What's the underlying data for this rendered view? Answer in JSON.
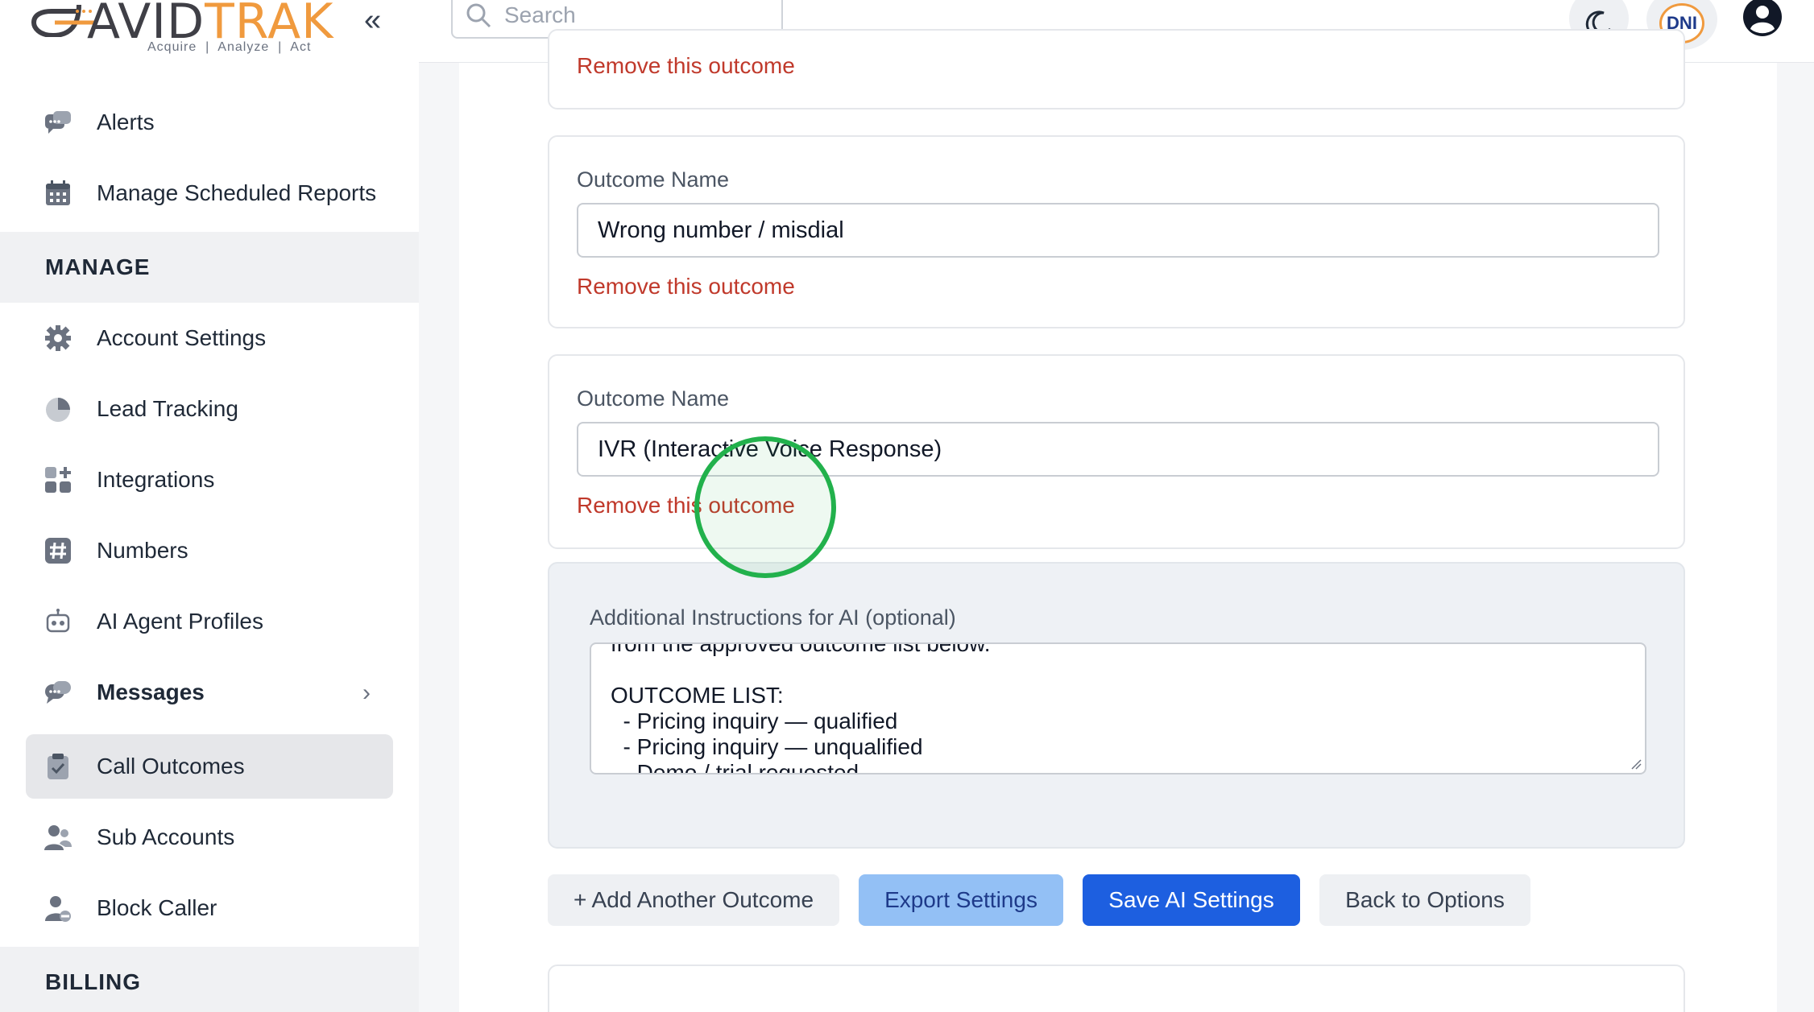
{
  "brand": {
    "name_a": "AVID",
    "name_b": "TRAK",
    "tagline": "Acquire  |  Analyze  |  Act",
    "collapse_glyph": "«"
  },
  "sidebar": {
    "items_top": [
      {
        "label": "Alerts",
        "icon": "chat-bubble-icon"
      },
      {
        "label": "Manage Scheduled Reports",
        "icon": "calendar-icon"
      }
    ],
    "section_manage": "MANAGE",
    "items_manage": [
      {
        "label": "Account Settings",
        "icon": "gear-icon"
      },
      {
        "label": "Lead Tracking",
        "icon": "pie-chart-icon"
      },
      {
        "label": "Integrations",
        "icon": "grid-plus-icon"
      },
      {
        "label": "Numbers",
        "icon": "hash-icon"
      },
      {
        "label": "AI Agent Profiles",
        "icon": "robot-icon"
      },
      {
        "label": "Messages",
        "icon": "chat-bubble-icon",
        "chevron": "›"
      },
      {
        "label": "Call Outcomes",
        "icon": "clipboard-check-icon"
      },
      {
        "label": "Sub Accounts",
        "icon": "users-icon"
      },
      {
        "label": "Block Caller",
        "icon": "user-block-icon"
      }
    ],
    "section_billing": "BILLING"
  },
  "topbar": {
    "search_placeholder": "Search",
    "avatar_initials": "DNI"
  },
  "outcomes": [
    {
      "remove_label": "Remove this outcome"
    },
    {
      "field_label": "Outcome Name",
      "value": "Wrong number / misdial",
      "remove_label": "Remove this outcome"
    },
    {
      "field_label": "Outcome Name",
      "value": "IVR (Interactive Voice Response)",
      "remove_label": "Remove this outcome"
    }
  ],
  "ai_instructions": {
    "label": "Additional Instructions for AI (optional)",
    "visible_text": "from the approved outcome list below.\n\nOUTCOME LIST:\n  - Pricing inquiry — qualified\n  - Pricing inquiry — unqualified\n  - Demo / trial requested"
  },
  "actions": {
    "add_label": "+ Add Another Outcome",
    "export_label": "Export Settings",
    "save_label": "Save AI Settings",
    "back_label": "Back to Options"
  },
  "colors": {
    "accent_orange": "#f09a3e",
    "primary_blue": "#1d5fe0",
    "export_blue": "#93c0f5",
    "remove_red": "#c0392b",
    "cursor_green": "#22b14c"
  }
}
